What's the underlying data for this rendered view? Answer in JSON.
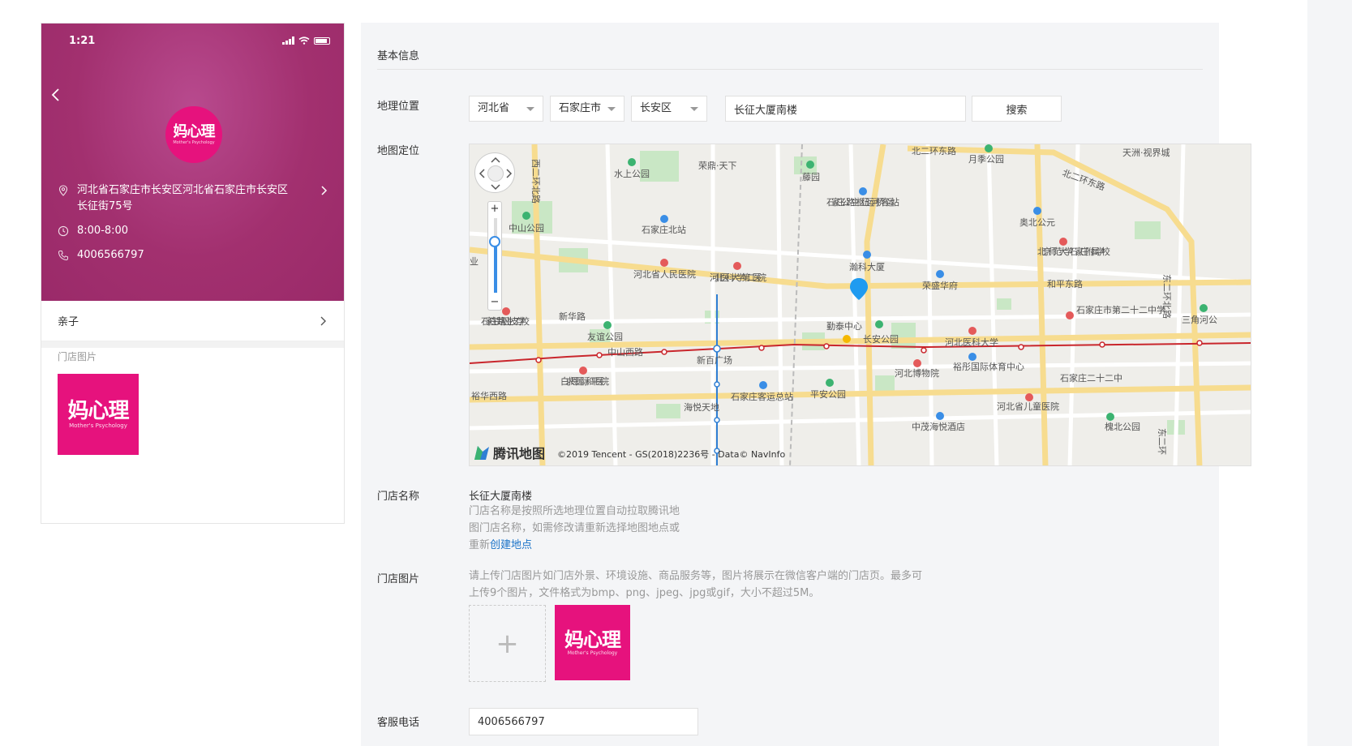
{
  "preview": {
    "status_time": "1:21",
    "logo_text": "妈心理",
    "logo_sub": "Mother's Psychology",
    "address": "河北省石家庄市长安区河北省石家庄市长安区长征街75号",
    "hours": "8:00-8:00",
    "phone": "4006566797",
    "tag": "亲子",
    "store_images_label": "门店图片",
    "icons": [
      "back-chevron-icon",
      "location-pin-icon",
      "clock-icon",
      "phone-icon",
      "chevron-right-icon"
    ],
    "colors": {
      "header": "#a2306f",
      "logo": "#e6127d"
    }
  },
  "form": {
    "section_title": "基本信息",
    "location_label": "地理位置",
    "province": "河北省",
    "city": "石家庄市",
    "district": "长安区",
    "address_value": "长征大厦南楼",
    "search_label": "搜索",
    "map_label": "地图定位",
    "store_name_label": "门店名称",
    "store_name_value": "长征大厦南楼",
    "store_name_hint": "门店名称是按照所选地理位置自动拉取腾讯地图门店名称，如需修改请重新选择地图地点或重新",
    "store_name_link": "创建地点",
    "store_images_label": "门店图片",
    "upload_hint": "请上传门店图片如门店外景、环境设施、商品服务等，图片将展示在微信客户端的门店页。最多可上传9个图片，文件格式为bmp、png、jpeg、jpg或gif，大小不超过5M。",
    "upload_plus": "+",
    "thumb_text": "妈心理",
    "thumb_sub": "Mother's Psychology",
    "phone_label": "客服电话",
    "phone_value": "4006566797"
  },
  "map": {
    "logo_text": "腾讯地图",
    "copyright": "©2019 Tencent - GS(2018)2236号 - Data© NavInfo",
    "zoom_in": "+",
    "zoom_out": "−",
    "labels": {
      "l1": "西二环北路",
      "l2": "水上公园",
      "l3": "荣鼎·天下",
      "l4": "藤园",
      "l5": "北二环东路",
      "l6": "月季公园",
      "l7": "天洲·视界城",
      "l8": "北二环东路",
      "l9": "中山公园",
      "l10": "石家庄北站",
      "l11": "石家庄公路主枢纽运河桥客运站",
      "l12": "奥北公元",
      "l13": "北京师范大学石家庄附属学校",
      "l14": "瀚科大厦",
      "l15": "河北省人民医院",
      "l16": "河北医科大学第二医院",
      "l17": "荣盛华府",
      "l18": "和平东路",
      "l19": "东二环北路",
      "l20": "新华路",
      "l21": "石家庄铁路职业技工学校",
      "l22": "友谊公园",
      "l23": "勤泰中心",
      "l24": "长安公园",
      "l25": "河北医科大学",
      "l26": "石家庄市第二十二中学",
      "l27": "三角河公",
      "l28": "中山西路",
      "l29": "新百广场",
      "l30": "白求恩国际和平医院",
      "l31": "河北博物院",
      "l32": "裕彤国际体育中心",
      "l33": "石家庄二十二中",
      "l34": "裕华西路",
      "l35": "石家庄客运总站",
      "l36": "平安公园",
      "l37": "海悦天地",
      "l38": "河北省儿童医院",
      "l39": "中茂海悦酒店",
      "l40": "槐北公园",
      "l41": "东二环",
      "l42": "业"
    }
  }
}
